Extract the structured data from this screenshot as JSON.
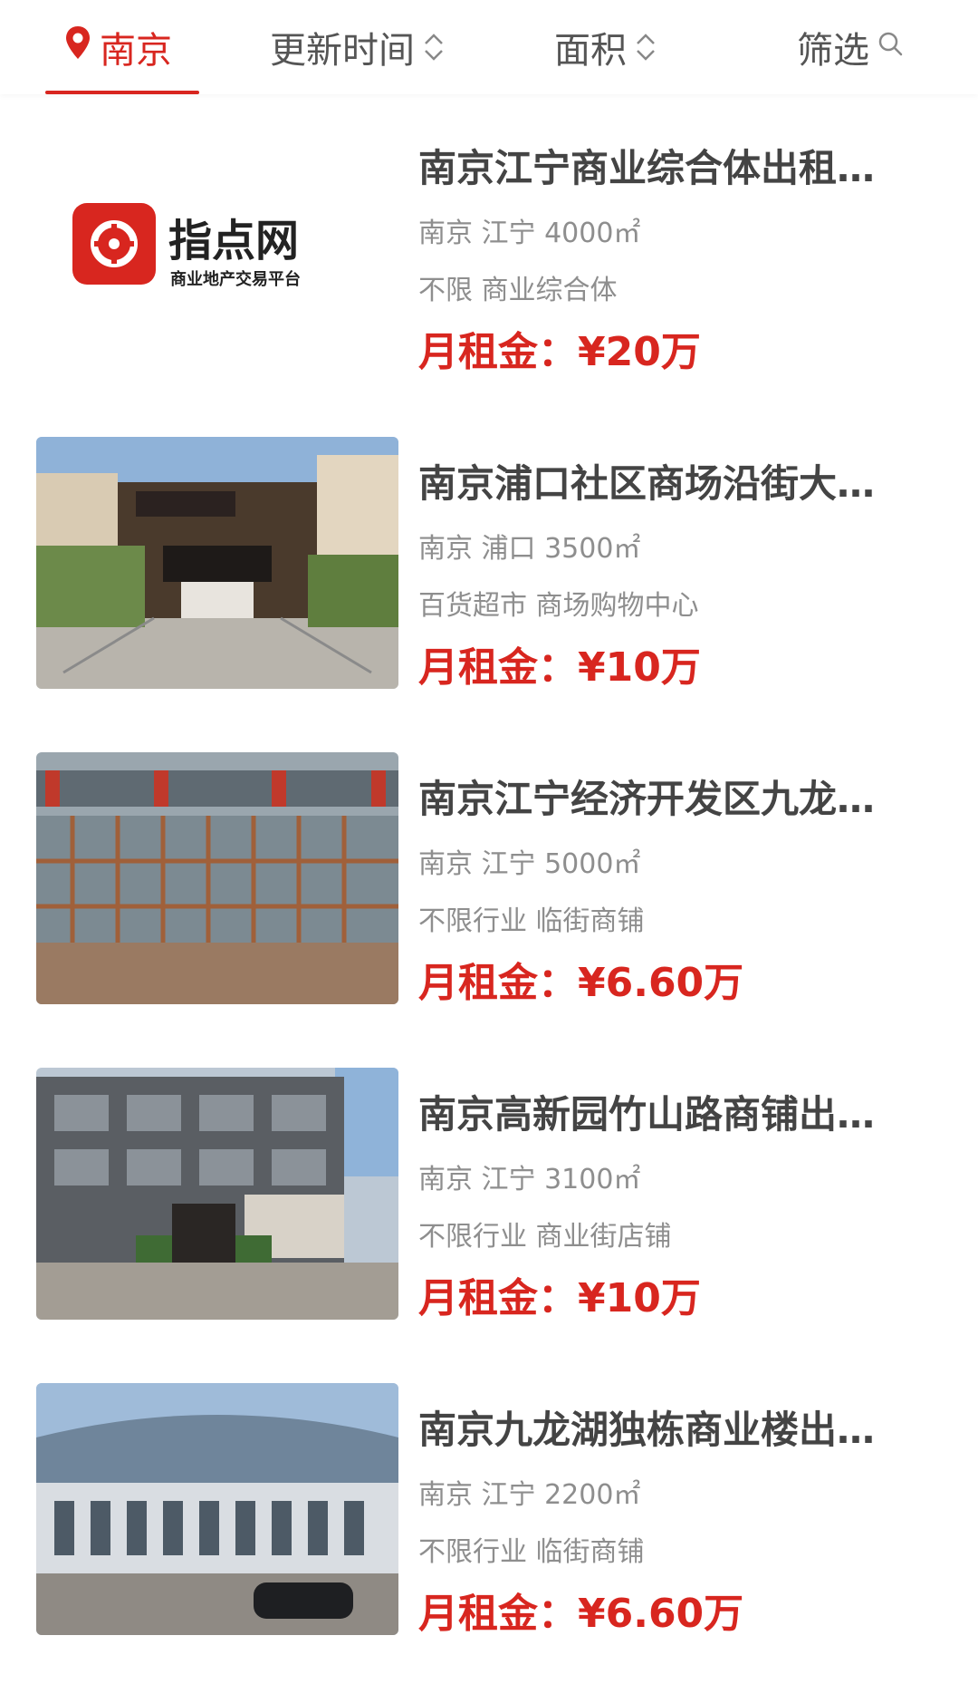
{
  "header": {
    "tabs": {
      "city": "南京",
      "update_time": "更新时间",
      "area": "面积",
      "filter": "筛选"
    },
    "accent_color": "#d8261f"
  },
  "listings": [
    {
      "title": "南京江宁商业综合体出租…",
      "location": "南京 江宁 4000㎡",
      "category": "不限 商业综合体",
      "price_label": "月租金：",
      "price": "¥20万",
      "logo_text": "指点网",
      "logo_subtext": "商业地产交易平台"
    },
    {
      "title": "南京浦口社区商场沿街大…",
      "location": "南京 浦口 3500㎡",
      "category": "百货超市 商场购物中心",
      "price_label": "月租金：",
      "price": "¥10万"
    },
    {
      "title": "南京江宁经济开发区九龙…",
      "location": "南京 江宁 5000㎡",
      "category": "不限行业 临街商铺",
      "price_label": "月租金：",
      "price": "¥6.60万"
    },
    {
      "title": "南京高新园竹山路商铺出…",
      "location": "南京 江宁 3100㎡",
      "category": "不限行业 商业街店铺",
      "price_label": "月租金：",
      "price": "¥10万"
    },
    {
      "title": "南京九龙湖独栋商业楼出…",
      "location": "南京 江宁 2200㎡",
      "category": "不限行业 临街商铺",
      "price_label": "月租金：",
      "price": "¥6.60万"
    }
  ]
}
